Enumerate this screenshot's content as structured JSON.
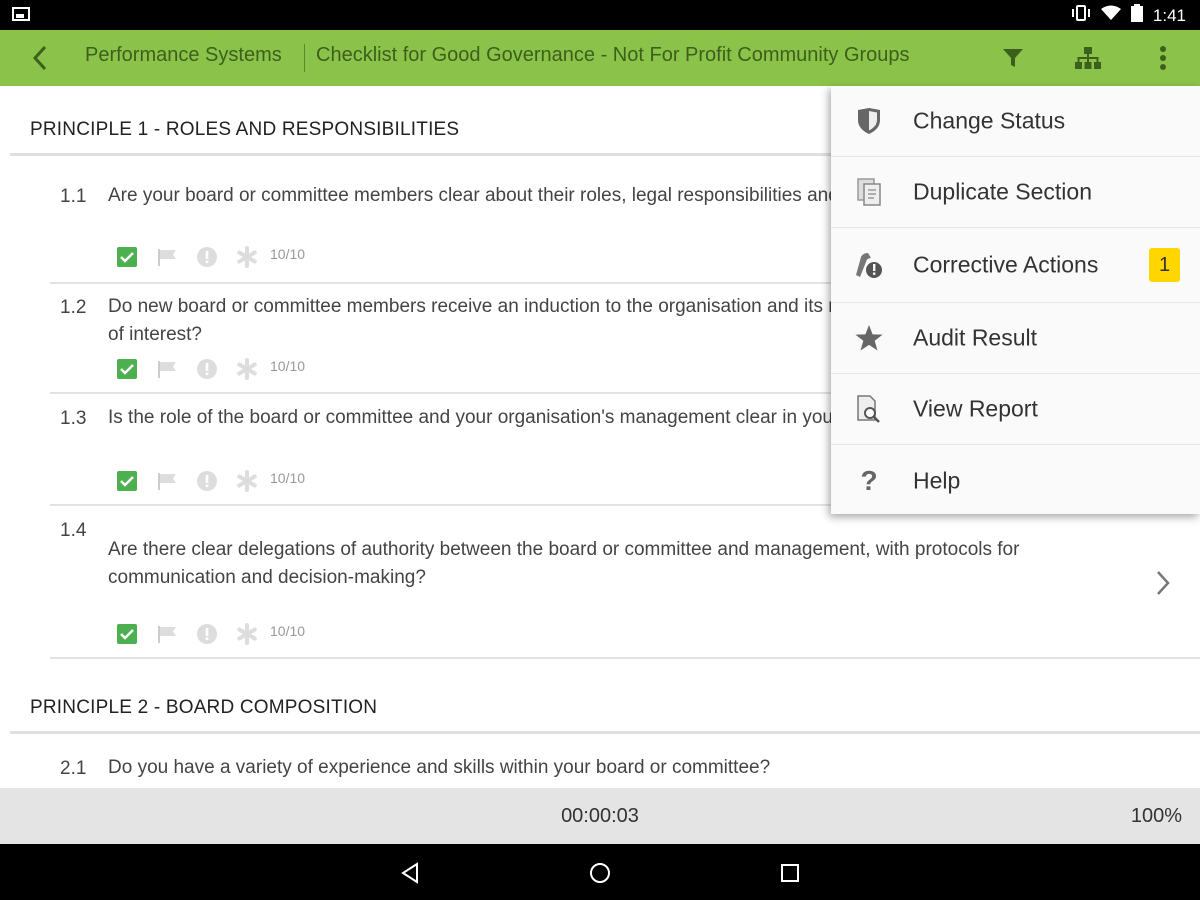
{
  "status_bar": {
    "time": "1:41"
  },
  "toolbar": {
    "breadcrumb_app": "Performance Systems",
    "breadcrumb_title": "Checklist for Good Governance - Not For Profit Community Groups",
    "icons": [
      "back-icon",
      "filter-icon",
      "hierarchy-icon",
      "overflow-menu-icon"
    ]
  },
  "sections": [
    {
      "title": "PRINCIPLE 1 - ROLES AND RESPONSIBILITIES",
      "questions": [
        {
          "number": "1.1",
          "text": "Are your board or committee members clear about their roles, legal responsibilities and expectations?",
          "score": "10/10"
        },
        {
          "number": "1.2",
          "text": "Do new board or committee members receive an induction to the organisation and its responsibilities - including conflict of interest?",
          "score": "10/10"
        },
        {
          "number": "1.3",
          "text": "Is the role of the board or committee and your organisation's management clear in your constitution (or rules)?",
          "score": "10/10"
        },
        {
          "number": "1.4",
          "text": "Are there clear delegations of authority between the board or committee and management, with protocols for communication and decision-making?",
          "score": "10/10"
        }
      ]
    },
    {
      "title": "PRINCIPLE 2 - BOARD COMPOSITION",
      "questions": [
        {
          "number": "2.1",
          "text": "Do you have a variety of experience and skills within your board or committee?",
          "score": ""
        }
      ]
    }
  ],
  "footer": {
    "timer": "00:00:03",
    "progress": "100%"
  },
  "menu": {
    "items": [
      {
        "label": "Change Status",
        "icon": "shield-icon"
      },
      {
        "label": "Duplicate Section",
        "icon": "duplicate-icon"
      },
      {
        "label": "Corrective Actions",
        "icon": "corrective-actions-icon",
        "badge": "1"
      },
      {
        "label": "Audit Result",
        "icon": "star-icon"
      },
      {
        "label": "View Report",
        "icon": "view-report-icon"
      },
      {
        "label": "Help",
        "icon": "help-icon"
      }
    ]
  },
  "colors": {
    "toolbar_bg": "#8bc34a",
    "toolbar_text": "#3d5f1c",
    "check_green": "#4caf50",
    "badge_yellow": "#ffd600"
  }
}
